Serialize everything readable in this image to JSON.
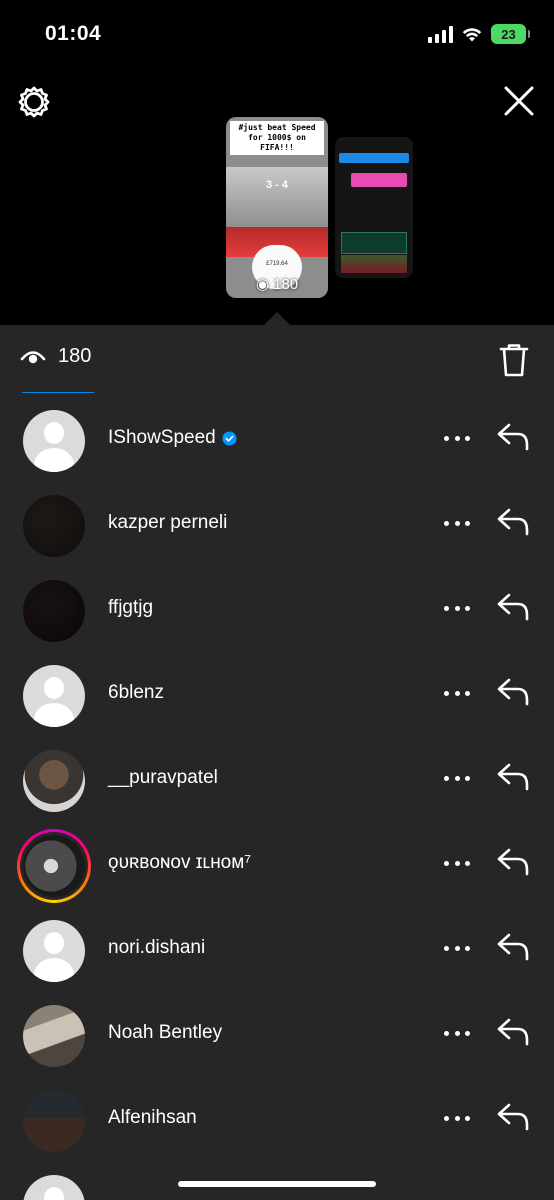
{
  "status_bar": {
    "time": "01:04",
    "battery": "23"
  },
  "top": {
    "settings_icon": "gear-icon",
    "close_icon": "close-icon"
  },
  "story_preview": {
    "caption": "#just beat Speed for 1000$ on FIFA!!!",
    "score": "3 - 4",
    "price": "£719.64",
    "views_overlay": "180"
  },
  "sheet": {
    "views_count": "180",
    "trash_icon": "trash-icon"
  },
  "viewers": [
    {
      "name": "IShowSpeed",
      "verified": true,
      "avatar": "default"
    },
    {
      "name": "kazper perneli",
      "verified": false,
      "avatar": "dark"
    },
    {
      "name": "ffjgtjg",
      "verified": false,
      "avatar": "dark2"
    },
    {
      "name": "6blenz",
      "verified": false,
      "avatar": "default"
    },
    {
      "name": "__puravpatel",
      "verified": false,
      "avatar": "photo1"
    },
    {
      "name": "ǫᴜʀʙᴏɴᴏᴠ ɪʟʜᴏᴍ⁷",
      "verified": false,
      "avatar": "story-ring"
    },
    {
      "name": "nori.dishani",
      "verified": false,
      "avatar": "default"
    },
    {
      "name": "Noah Bentley",
      "verified": false,
      "avatar": "photo3"
    },
    {
      "name": "Alfenihsan",
      "verified": false,
      "avatar": "photo4"
    }
  ],
  "colors": {
    "sheet_bg": "#262626",
    "accent_blue": "#0095f6",
    "battery_green": "#4cd964"
  }
}
